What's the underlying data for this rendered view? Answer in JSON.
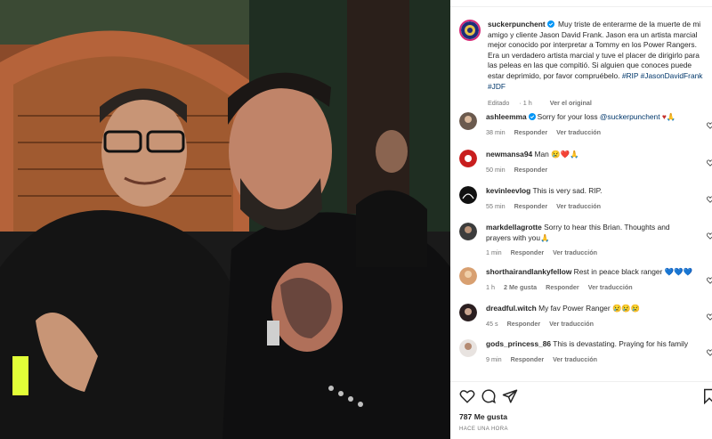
{
  "post": {
    "username": "suckerpunchent",
    "caption_text": " Muy triste de enterarme de la muerte de mi amigo y cliente Jason David Frank. Jason era un artista marcial mejor conocido por interpretar a Tommy en los Power Rangers. Era un verdadero artista marcial y tuve el placer de dirigirlo para las peleas en las que compitió. Si alguien que conoces puede estar deprimido, por favor compruébelo. ",
    "hashtags": [
      "#RIP",
      "#JasonDavidFrank",
      "#JDF"
    ],
    "edited_label": "Editado",
    "time": "1 h",
    "see_original": "Ver el original",
    "likes": "787 Me gusta",
    "ago": "HACE UNA HORA"
  },
  "comments": [
    {
      "username": "ashleemma",
      "verified": true,
      "text": "Sorry for your loss ",
      "mention": "@suckerpunchent",
      "emoji": "♥🙏",
      "time": "38 min",
      "reply": "Responder",
      "translate": "Ver traducción",
      "likes": ""
    },
    {
      "username": "newmansa94",
      "verified": false,
      "text": "Man ",
      "mention": "",
      "emoji": "😢❤️🙏",
      "time": "50 min",
      "reply": "Responder",
      "translate": "",
      "likes": ""
    },
    {
      "username": "kevinleevlog",
      "verified": false,
      "text": "This is very sad. RIP.",
      "mention": "",
      "emoji": "",
      "time": "55 min",
      "reply": "Responder",
      "translate": "Ver traducción",
      "likes": ""
    },
    {
      "username": "markdellagrotte",
      "verified": false,
      "text": "Sorry to hear this Brian. Thoughts and prayers with you",
      "mention": "",
      "emoji": "🙏",
      "time": "1 min",
      "reply": "Responder",
      "translate": "Ver traducción",
      "likes": ""
    },
    {
      "username": "shorthairandlankyfellow",
      "verified": false,
      "text": "Rest in peace black ranger ",
      "mention": "",
      "emoji": "💙💙💙",
      "time": "1 h",
      "reply": "Responder",
      "translate": "Ver traducción",
      "likes": "2 Me gusta"
    },
    {
      "username": "dreadful.witch",
      "verified": false,
      "text": "My fav Power Ranger ",
      "mention": "",
      "emoji": "😢😢😢",
      "time": "45 s",
      "reply": "Responder",
      "translate": "Ver traducción",
      "likes": ""
    },
    {
      "username": "gods_princess_86",
      "verified": false,
      "text": "This is devastating. Praying for his family",
      "mention": "",
      "emoji": "",
      "time": "9 min",
      "reply": "Responder",
      "translate": "Ver traducción",
      "likes": ""
    }
  ],
  "colors": {
    "link": "#00376b",
    "verified": "#0095f6",
    "muted": "#737373",
    "heart": "#ed4956"
  }
}
